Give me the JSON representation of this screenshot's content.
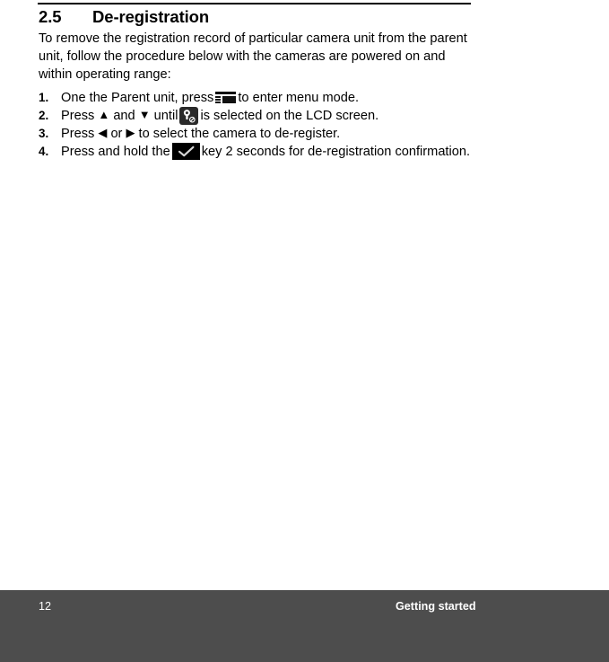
{
  "document": {
    "heading": {
      "section_number": "2.5",
      "title": "De-registration"
    },
    "intro_paragraph": "To remove the registration record of particular camera unit from the parent unit, follow the procedure below with the cameras are powered on and within operating range:",
    "steps": [
      {
        "number": "1.",
        "text_before": "One the Parent unit, press",
        "icon": "menu-icon",
        "text_after": "to enter menu mode."
      },
      {
        "number": "2.",
        "text_before": "Press",
        "glyph_up": "▲",
        "text_mid_1": "and",
        "glyph_down": "▼",
        "text_mid_2": "until",
        "icon": "camera-deregister-icon",
        "text_after": "is selected on the LCD screen."
      },
      {
        "number": "3.",
        "text_before": "Press",
        "glyph_left": "◀",
        "text_mid_1": "or",
        "glyph_right": "▶",
        "text_after": "to select the camera to de-register."
      },
      {
        "number": "4.",
        "text_before": "Press and hold the",
        "icon": "confirm-key-icon",
        "text_after": "key 2 seconds for de-registration confirmation."
      }
    ]
  },
  "footer": {
    "page_number": "12",
    "section_name": "Getting started",
    "background_color": "#4d4d4d",
    "text_color": "#ffffff"
  }
}
